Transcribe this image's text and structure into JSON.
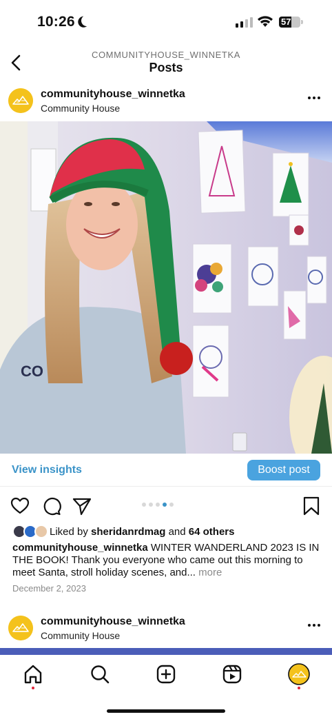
{
  "status_bar": {
    "time": "10:26",
    "battery": "57",
    "battery_level": 0.57
  },
  "header": {
    "account_label": "COMMUNITYHOUSE_WINNETKA",
    "title": "Posts"
  },
  "post": {
    "username": "communityhouse_winnetka",
    "display_name": "Community House",
    "image_alt": "Girl in elf hat in front of holiday drawings",
    "insights_label": "View insights",
    "boost_label": "Boost post",
    "carousel": {
      "count": 5,
      "active": 3
    },
    "likes": {
      "prefix": "Liked by",
      "user": "sheridanrdmag",
      "conjunction": "and",
      "others": "64 others"
    },
    "caption": {
      "username": "communityhouse_winnetka",
      "text": "WINTER WANDERLAND 2023 IS IN THE BOOK! Thank you everyone who came out this morning to meet Santa, stroll holiday scenes, and...",
      "more": "more"
    },
    "date": "December 2, 2023"
  },
  "next_post": {
    "username": "communityhouse_winnetka",
    "display_name": "Community House"
  },
  "tab_bar": {
    "items": [
      "home-icon",
      "search-icon",
      "create-icon",
      "reels-icon",
      "profile-avatar"
    ],
    "accent": "#e0243a"
  },
  "colors": {
    "link": "#3a93c8",
    "boost": "#4aa3df",
    "avatar": "#f4c21c"
  }
}
